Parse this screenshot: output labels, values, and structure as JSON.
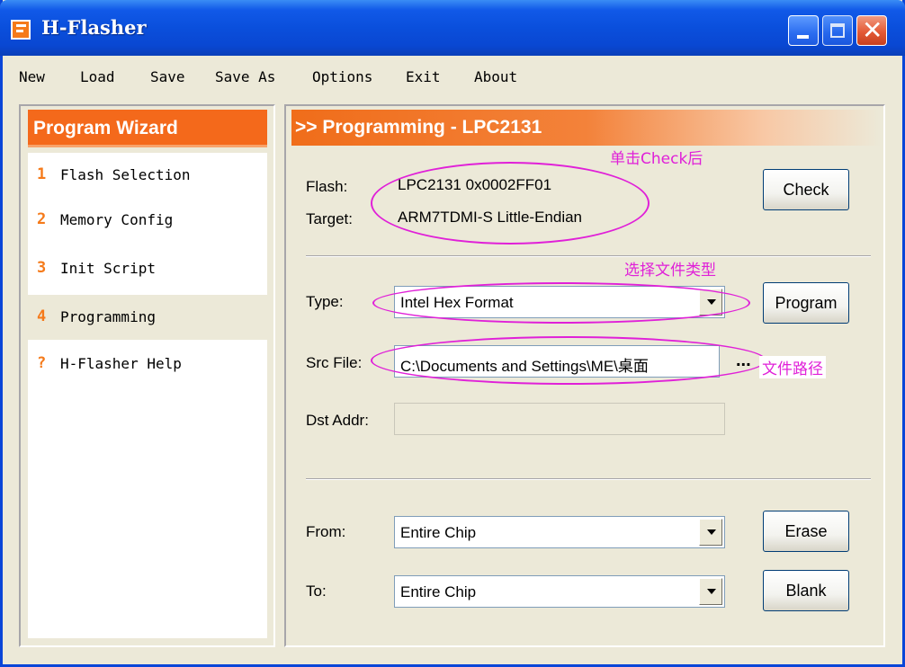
{
  "window": {
    "title": "H-Flasher"
  },
  "menu": [
    "New",
    "Load",
    "Save",
    "Save As",
    "Options",
    "Exit",
    "About"
  ],
  "wizard": {
    "header": "Program Wizard",
    "items": [
      {
        "num": "1",
        "label": "Flash Selection"
      },
      {
        "num": "2",
        "label": "Memory Config"
      },
      {
        "num": "3",
        "label": "Init Script"
      },
      {
        "num": "4",
        "label": "Programming"
      },
      {
        "num": "?",
        "label": "H-Flasher Help"
      }
    ]
  },
  "programming": {
    "header": ">> Programming - LPC2131",
    "flash_label": "Flash:",
    "flash_value": "LPC2131  0x0002FF01",
    "target_label": "Target:",
    "target_value": "ARM7TDMI-S  Little-Endian",
    "check_button": "Check",
    "type_label": "Type:",
    "type_value": "Intel Hex Format",
    "program_button": "Program",
    "src_label": "Src File:",
    "src_value": "C:\\Documents and Settings\\ME\\桌面",
    "browse": "...",
    "dst_label": "Dst Addr:",
    "from_label": "From:",
    "from_value": "Entire Chip",
    "erase_button": "Erase",
    "to_label": "To:",
    "to_value": "Entire Chip",
    "blank_button": "Blank"
  },
  "annotations": {
    "check_note": "单击Check后",
    "type_note": "选择文件类型",
    "path_note": "文件路径",
    "color": "#e020d8"
  }
}
